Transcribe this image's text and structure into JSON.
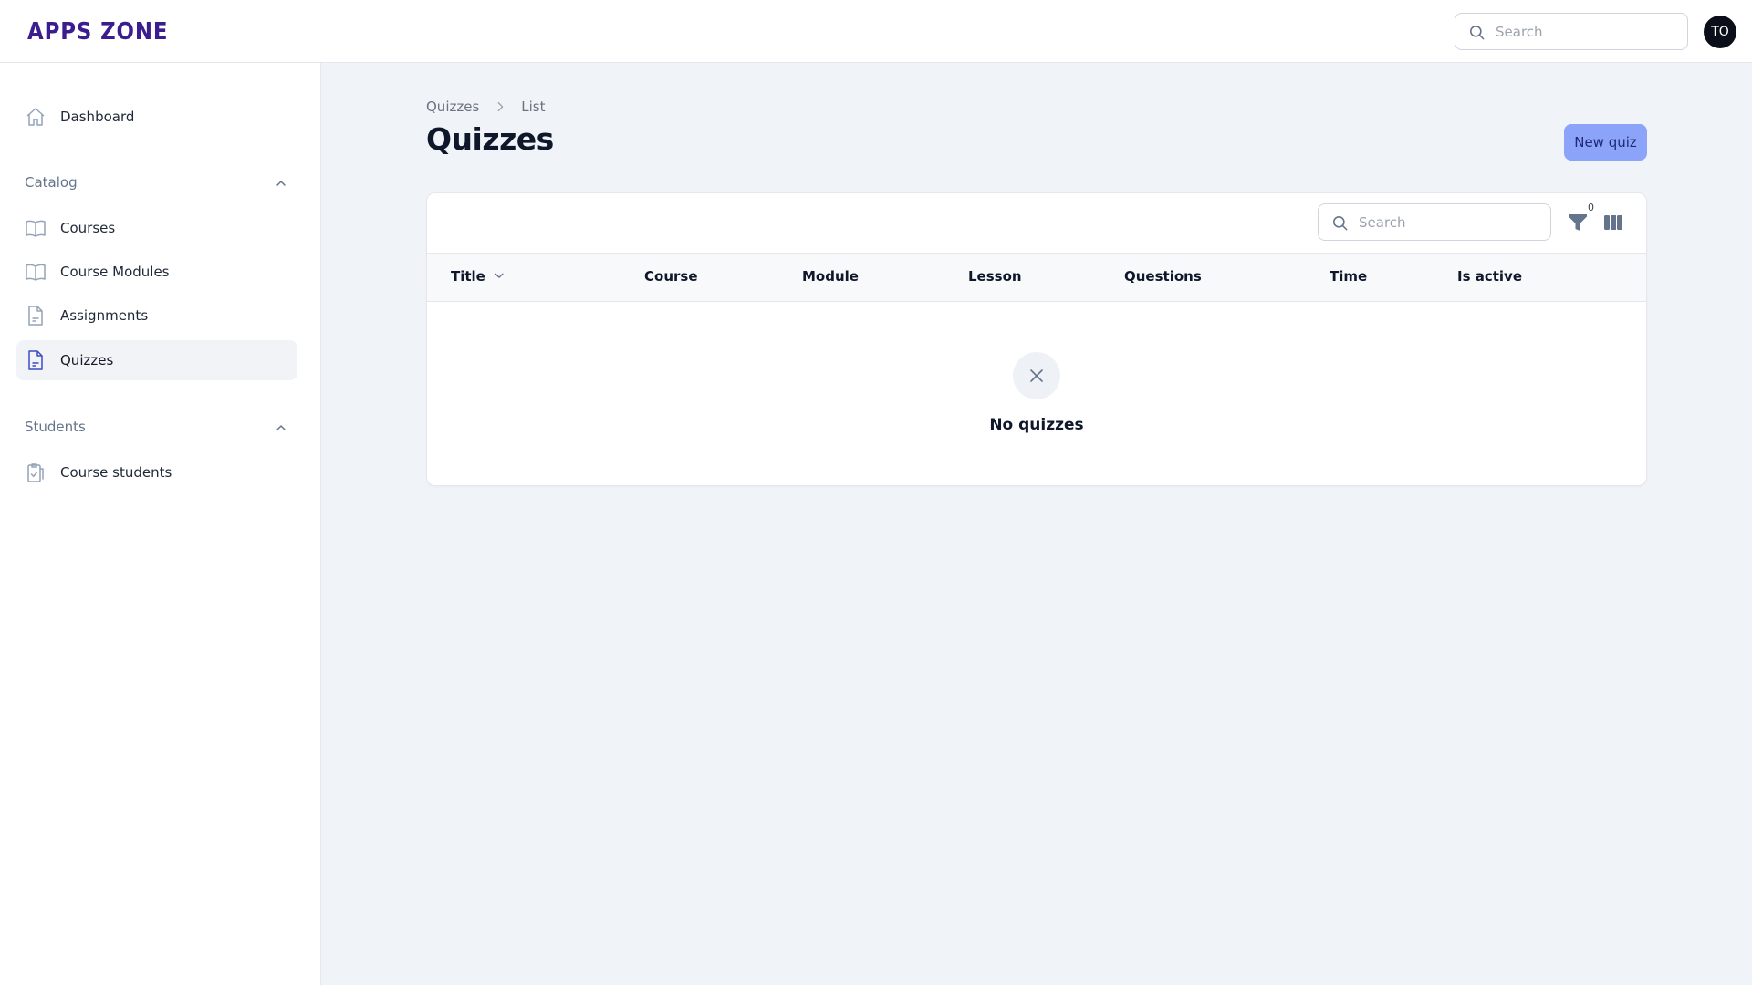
{
  "header": {
    "logo_text": "APPS ZONE",
    "search_placeholder": "Search",
    "avatar_initials": "TO"
  },
  "sidebar": {
    "dashboard": {
      "label": "Dashboard",
      "icon": "home-icon"
    },
    "groups": [
      {
        "label": "Catalog",
        "items": [
          {
            "label": "Courses",
            "icon": "book-icon"
          },
          {
            "label": "Course Modules",
            "icon": "book-icon"
          },
          {
            "label": "Assignments",
            "icon": "document-icon"
          },
          {
            "label": "Quizzes",
            "icon": "document-icon",
            "active": true
          }
        ]
      },
      {
        "label": "Students",
        "items": [
          {
            "label": "Course students",
            "icon": "clipboard-check-icon"
          }
        ]
      }
    ]
  },
  "main": {
    "breadcrumb": [
      "Quizzes",
      "List"
    ],
    "title": "Quizzes",
    "new_button": "New quiz",
    "table": {
      "search_placeholder": "Search",
      "filter_count": "0",
      "columns": [
        "Title",
        "Course",
        "Module",
        "Lesson",
        "Questions",
        "Time",
        "Is active"
      ],
      "rows": [],
      "empty_text": "No quizzes"
    }
  },
  "colors": {
    "logo": "#3b1d8f",
    "primary_button": "#8ba4f9",
    "page_bg": "#f0f4f8",
    "icon": "#64748b",
    "active_icon": "#3b4fc4"
  }
}
